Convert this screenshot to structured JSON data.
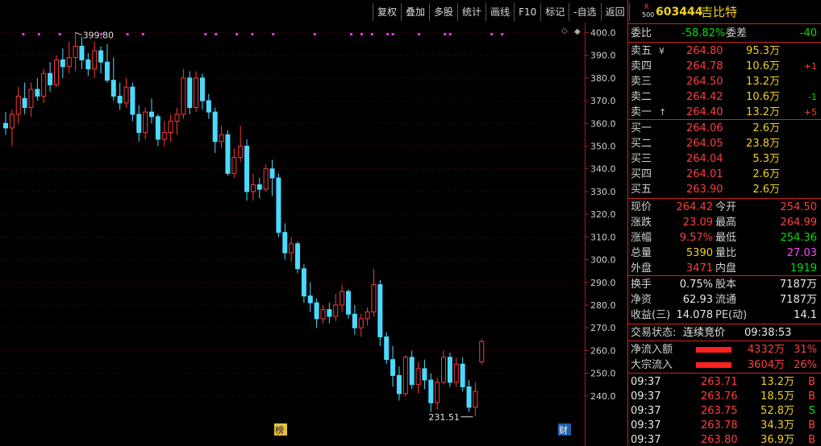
{
  "toolbar": {
    "items": [
      "复权",
      "叠加",
      "多股",
      "统计",
      "画线",
      "F10",
      "标记",
      "-自选",
      "返回"
    ]
  },
  "header": {
    "badge_top": "R",
    "badge_bottom": "500",
    "code": "603444",
    "name": "吉比特"
  },
  "quote": {
    "weibi_label": "委比",
    "weibi_value": "-58.82%",
    "weicha_label": "委差",
    "weicha_value": "-40",
    "asks": [
      {
        "label": "卖五",
        "mark": "¥",
        "price": "264.80",
        "vol": "95.3万",
        "chg": ""
      },
      {
        "label": "卖四",
        "mark": "",
        "price": "264.78",
        "vol": "10.6万",
        "chg": "+1"
      },
      {
        "label": "卖三",
        "mark": "",
        "price": "264.50",
        "vol": "13.2万",
        "chg": ""
      },
      {
        "label": "卖二",
        "mark": "",
        "price": "264.42",
        "vol": "10.6万",
        "chg": "-1"
      },
      {
        "label": "卖一",
        "mark": "↑",
        "price": "264.40",
        "vol": "13.2万",
        "chg": "+5"
      }
    ],
    "bids": [
      {
        "label": "买一",
        "price": "264.06",
        "vol": "2.6万"
      },
      {
        "label": "买二",
        "price": "264.05",
        "vol": "23.8万"
      },
      {
        "label": "买三",
        "price": "264.04",
        "vol": "5.3万"
      },
      {
        "label": "买四",
        "price": "264.01",
        "vol": "2.6万"
      },
      {
        "label": "买五",
        "price": "263.90",
        "vol": "2.6万"
      }
    ],
    "stats": [
      {
        "l1": "现价",
        "v1": "264.42",
        "l2": "今开",
        "v2": "254.50"
      },
      {
        "l1": "涨跌",
        "v1": "23.09",
        "l2": "最高",
        "v2": "264.99"
      },
      {
        "l1": "涨幅",
        "v1": "9.57%",
        "l2": "最低",
        "v2": "254.36"
      },
      {
        "l1": "总量",
        "v1": "5390",
        "l2": "量比",
        "v2": "27.03"
      },
      {
        "l1": "外盘",
        "v1": "3471",
        "l2": "内盘",
        "v2": "1919"
      }
    ],
    "stats2": [
      {
        "l1": "换手",
        "v1": "0.75%",
        "l2": "股本",
        "v2": "7187万"
      },
      {
        "l1": "净资",
        "v1": "62.93",
        "l2": "流通",
        "v2": "7187万"
      },
      {
        "l1": "收益(三)",
        "v1": "14.078",
        "l2": "PE(动)",
        "v2": "14.1"
      }
    ],
    "trade_state_label": "交易状态:",
    "trade_state_value": "连续竞价",
    "trade_time": "09:38:53",
    "flows": [
      {
        "label": "净流入额",
        "value": "4332万",
        "pct": "31%"
      },
      {
        "label": "大宗流入",
        "value": "3604万",
        "pct": "26%"
      }
    ],
    "ticks": [
      {
        "time": "09:37",
        "price": "263.71",
        "vol": "13.2万",
        "side": "B"
      },
      {
        "time": "09:37",
        "price": "263.76",
        "vol": "18.5万",
        "side": "B"
      },
      {
        "time": "09:37",
        "price": "263.75",
        "vol": "52.8万",
        "side": "S"
      },
      {
        "time": "09:37",
        "price": "263.78",
        "vol": "34.3万",
        "side": "B"
      },
      {
        "time": "09:37",
        "price": "263.80",
        "vol": "36.9万",
        "side": "B"
      }
    ]
  },
  "chart_data": {
    "type": "candlestick",
    "ylim": [
      230,
      403
    ],
    "yticks": [
      "400.0",
      "390.0",
      "380.0",
      "370.0",
      "360.0",
      "350.0",
      "340.0",
      "330.0",
      "320.0",
      "310.0",
      "300.0",
      "290.0",
      "280.0",
      "270.0",
      "260.0",
      "250.0",
      "240.0"
    ],
    "max_label": "399.80",
    "min_label": "231.51",
    "badge_left": "榜",
    "badge_right": "财",
    "candles": [
      [
        360,
        365,
        355,
        358
      ],
      [
        358,
        366,
        350,
        364
      ],
      [
        364,
        376,
        360,
        372
      ],
      [
        371,
        378,
        364,
        367
      ],
      [
        367,
        378,
        363,
        375
      ],
      [
        375,
        380,
        370,
        372
      ],
      [
        372,
        384,
        369,
        382
      ],
      [
        382,
        387,
        374,
        377
      ],
      [
        377,
        390,
        376,
        388
      ],
      [
        388,
        393,
        380,
        385
      ],
      [
        385,
        396,
        382,
        389
      ],
      [
        389,
        400,
        383,
        394
      ],
      [
        394,
        398,
        384,
        388
      ],
      [
        388,
        391,
        381,
        384
      ],
      [
        384,
        396,
        380,
        392
      ],
      [
        392,
        394,
        382,
        387
      ],
      [
        387,
        395,
        378,
        379
      ],
      [
        379,
        389,
        370,
        372
      ],
      [
        372,
        378,
        366,
        369
      ],
      [
        369,
        380,
        367,
        376
      ],
      [
        376,
        378,
        361,
        364
      ],
      [
        364,
        368,
        352,
        356
      ],
      [
        356,
        367,
        353,
        365
      ],
      [
        365,
        371,
        360,
        363
      ],
      [
        363,
        364,
        350,
        353
      ],
      [
        353,
        361,
        350,
        356
      ],
      [
        356,
        364,
        352,
        361
      ],
      [
        361,
        367,
        355,
        364
      ],
      [
        364,
        384,
        362,
        380
      ],
      [
        380,
        383,
        364,
        367
      ],
      [
        367,
        383,
        365,
        380
      ],
      [
        380,
        382,
        366,
        370
      ],
      [
        370,
        373,
        362,
        365
      ],
      [
        365,
        367,
        347,
        352
      ],
      [
        352,
        359,
        349,
        355
      ],
      [
        355,
        357,
        337,
        338
      ],
      [
        338,
        349,
        336,
        345
      ],
      [
        345,
        359,
        343,
        350
      ],
      [
        350,
        353,
        326,
        330
      ],
      [
        330,
        338,
        326,
        333
      ],
      [
        333,
        336,
        327,
        331
      ],
      [
        331,
        342,
        330,
        340
      ],
      [
        340,
        344,
        328,
        336
      ],
      [
        336,
        338,
        310,
        312
      ],
      [
        312,
        316,
        300,
        303
      ],
      [
        303,
        310,
        299,
        307
      ],
      [
        307,
        308,
        294,
        296
      ],
      [
        296,
        298,
        281,
        284
      ],
      [
        284,
        290,
        277,
        281
      ],
      [
        281,
        283,
        270,
        274
      ],
      [
        274,
        280,
        272,
        278
      ],
      [
        278,
        281,
        272,
        275
      ],
      [
        275,
        285,
        273,
        280
      ],
      [
        280,
        289,
        277,
        286
      ],
      [
        286,
        287,
        274,
        276
      ],
      [
        276,
        280,
        267,
        270
      ],
      [
        270,
        276,
        266,
        274
      ],
      [
        274,
        279,
        271,
        277
      ],
      [
        277,
        296,
        275,
        289
      ],
      [
        289,
        291,
        262,
        266
      ],
      [
        266,
        268,
        254,
        256
      ],
      [
        256,
        262,
        244,
        249
      ],
      [
        249,
        253,
        238,
        241
      ],
      [
        241,
        258,
        240,
        257
      ],
      [
        257,
        260,
        243,
        245
      ],
      [
        245,
        255,
        241,
        252
      ],
      [
        252,
        256,
        243,
        247
      ],
      [
        247,
        250,
        233,
        237
      ],
      [
        237,
        248,
        234,
        246
      ],
      [
        246,
        260,
        245,
        257
      ],
      [
        257,
        259,
        244,
        246
      ],
      [
        246,
        257,
        244,
        254
      ],
      [
        254,
        257,
        242,
        244
      ],
      [
        244,
        247,
        233,
        235
      ],
      [
        235,
        246,
        231,
        242
      ],
      [
        255,
        265,
        254,
        264
      ]
    ],
    "markers_top": [
      1,
      4,
      8,
      16,
      21,
      24,
      36,
      38,
      42,
      45,
      49,
      57,
      64,
      66,
      68,
      71,
      72,
      77,
      82,
      83,
      91,
      93
    ]
  }
}
